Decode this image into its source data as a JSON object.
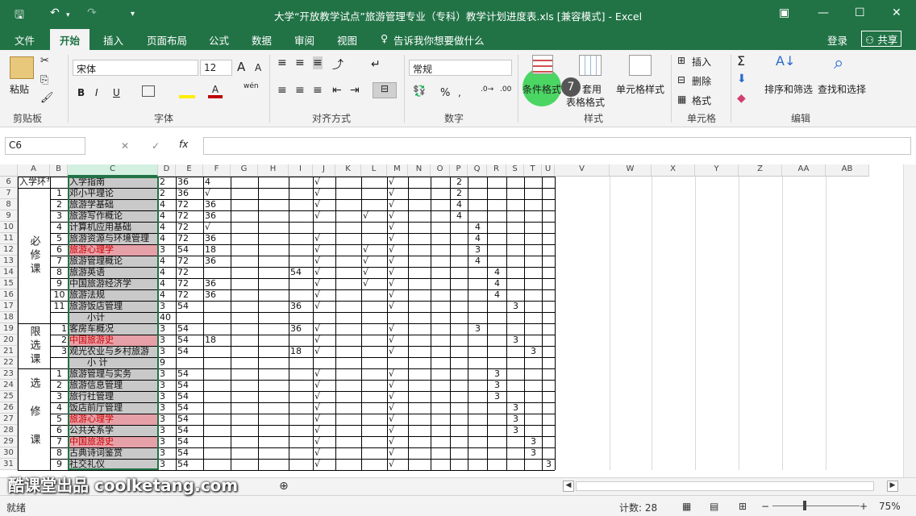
{
  "window": {
    "title": "大学“开放教学试点”旅游管理专业（专科）教学计划进度表.xls  [兼容模式] - Excel"
  },
  "tabs": [
    "文件",
    "开始",
    "插入",
    "页面布局",
    "公式",
    "数据",
    "审阅",
    "视图"
  ],
  "tell_me": "告诉我你想要做什么",
  "login": "登录",
  "share": "共享",
  "ribbon": {
    "clipboard": {
      "paste": "粘贴",
      "label": "剪贴板"
    },
    "font": {
      "name": "宋体",
      "size": "12",
      "bold": "B",
      "italic": "I",
      "underline": "U",
      "label": "字体",
      "wen": "wén"
    },
    "align": {
      "label": "对齐方式"
    },
    "number": {
      "format": "常规",
      "percent": "%",
      "label": "数字"
    },
    "styles": {
      "cond": "条件格式",
      "table1": "套用",
      "table2": "表格格式",
      "cell": "单元格样式",
      "label": "样式",
      "badge": "7"
    },
    "cells": {
      "insert": "插入",
      "delete": "删除",
      "format": "格式",
      "label": "单元格"
    },
    "edit": {
      "sort": "排序和筛选",
      "find": "查找和选择",
      "label": "编辑"
    }
  },
  "formula": {
    "namebox": "C6",
    "fx": "fx",
    "x": "✕",
    "check": "✓"
  },
  "columns": [
    "A",
    "B",
    "C",
    "D",
    "E",
    "F",
    "G",
    "H",
    "I",
    "J",
    "K",
    "L",
    "M",
    "N",
    "O",
    "P",
    "Q",
    "R",
    "S",
    "T",
    "U",
    "V",
    "W",
    "X",
    "Y",
    "Z",
    "AA",
    "AB"
  ],
  "rows": [
    {
      "r": "6",
      "a": "入学环节",
      "b": "",
      "c": "入学指南",
      "d": "2",
      "e": "36",
      "f": "4",
      "i": "",
      "j": "√",
      "l": "",
      "m": "√",
      "p": "2"
    },
    {
      "r": "7",
      "b": "1",
      "c": "邓小平理论",
      "d": "2",
      "e": "36",
      "f": "√",
      "j": "√",
      "m": "√",
      "p": "2"
    },
    {
      "r": "8",
      "b": "2",
      "c": "旅游学基础",
      "d": "4",
      "e": "72",
      "f": "36",
      "j": "√",
      "m": "√",
      "p": "4"
    },
    {
      "r": "9",
      "b": "3",
      "c": "旅游写作概论",
      "d": "4",
      "e": "72",
      "f": "36",
      "j": "√",
      "l": "√",
      "m": "√",
      "p": "4"
    },
    {
      "r": "10",
      "b": "4",
      "c": "计算机应用基础",
      "d": "4",
      "e": "72",
      "f": "√",
      "m": "√",
      "q": "4"
    },
    {
      "r": "11",
      "b": "5",
      "c": "旅游资源与环境管理",
      "d": "4",
      "e": "72",
      "f": "36",
      "j": "√",
      "m": "√",
      "q": "4"
    },
    {
      "r": "12",
      "b": "6",
      "c": "旅游心理学",
      "red": true,
      "d": "3",
      "e": "54",
      "f": "18",
      "j": "√",
      "l": "√",
      "m": "√",
      "q": "3"
    },
    {
      "r": "13",
      "b": "7",
      "c": "旅游管理概论",
      "d": "4",
      "e": "72",
      "f": "36",
      "j": "√",
      "l": "√",
      "m": "√",
      "q": "4"
    },
    {
      "r": "14",
      "b": "8",
      "c": "旅游英语",
      "d": "4",
      "e": "72",
      "i": "54",
      "j": "√",
      "l": "√",
      "m": "√",
      "r2": "4"
    },
    {
      "r": "15",
      "b": "9",
      "c": "中国旅游经济学",
      "d": "4",
      "e": "72",
      "f": "36",
      "j": "√",
      "l": "√",
      "m": "√",
      "r2": "4"
    },
    {
      "r": "16",
      "b": "10",
      "c": "旅游法规",
      "d": "4",
      "e": "72",
      "f": "36",
      "j": "√",
      "m": "√",
      "r2": "4"
    },
    {
      "r": "17",
      "b": "11",
      "c": "旅游饭店管理",
      "d": "3",
      "e": "54",
      "i": "36",
      "j": "√",
      "m": "√",
      "s": "3"
    },
    {
      "r": "18",
      "c": "小计",
      "d": "40"
    },
    {
      "r": "19",
      "b": "1",
      "c": "客房车概况",
      "d": "3",
      "e": "54",
      "i": "36",
      "j": "√",
      "m": "√",
      "q": "3"
    },
    {
      "r": "20",
      "b": "2",
      "c": "中国旅游史",
      "red": true,
      "d": "3",
      "e": "54",
      "f": "18",
      "j": "√",
      "m": "√",
      "s": "3"
    },
    {
      "r": "21",
      "b": "3",
      "c": "观光农业与乡村旅游",
      "d": "3",
      "e": "54",
      "i": "18",
      "j": "√",
      "m": "√",
      "t": "3"
    },
    {
      "r": "22",
      "c": "小  计",
      "d": "9"
    },
    {
      "r": "23",
      "b": "1",
      "c": "旅游管理与实务",
      "d": "3",
      "e": "54",
      "j": "√",
      "m": "√",
      "r2": "3"
    },
    {
      "r": "24",
      "b": "2",
      "c": "旅游信息管理",
      "d": "3",
      "e": "54",
      "j": "√",
      "m": "√",
      "r2": "3"
    },
    {
      "r": "25",
      "b": "3",
      "c": "旅行社管理",
      "d": "3",
      "e": "54",
      "j": "√",
      "m": "√",
      "r2": "3"
    },
    {
      "r": "26",
      "b": "4",
      "c": "饭店前厅管理",
      "d": "3",
      "e": "54",
      "j": "√",
      "m": "√",
      "s": "3"
    },
    {
      "r": "27",
      "b": "5",
      "c": "旅游心理学",
      "red": true,
      "d": "3",
      "e": "54",
      "j": "√",
      "m": "√",
      "s": "3"
    },
    {
      "r": "28",
      "b": "6",
      "c": "公共关系学",
      "d": "3",
      "e": "54",
      "j": "√",
      "m": "√",
      "s": "3"
    },
    {
      "r": "29",
      "b": "7",
      "c": "中国旅游史",
      "red": true,
      "d": "3",
      "e": "54",
      "j": "√",
      "m": "√",
      "t": "3"
    },
    {
      "r": "30",
      "b": "8",
      "c": "古典诗词鉴赏",
      "d": "3",
      "e": "54",
      "j": "√",
      "m": "√",
      "t": "3"
    },
    {
      "r": "31",
      "b": "9",
      "c": "社交礼仪",
      "d": "3",
      "e": "54",
      "j": "√",
      "m": "√",
      "u": "3"
    }
  ],
  "groups": [
    {
      "text": "必修课",
      "row_start": 1,
      "row_end": 12
    },
    {
      "text": "限选课",
      "row_start": 13,
      "row_end": 16
    },
    {
      "text": "选修课",
      "row_start": 17,
      "row_end": 25
    }
  ],
  "status": {
    "ready": "就绪",
    "count": "计数: 28",
    "zoom": "75%"
  },
  "watermark": "酷课堂出品 coolketang.com"
}
